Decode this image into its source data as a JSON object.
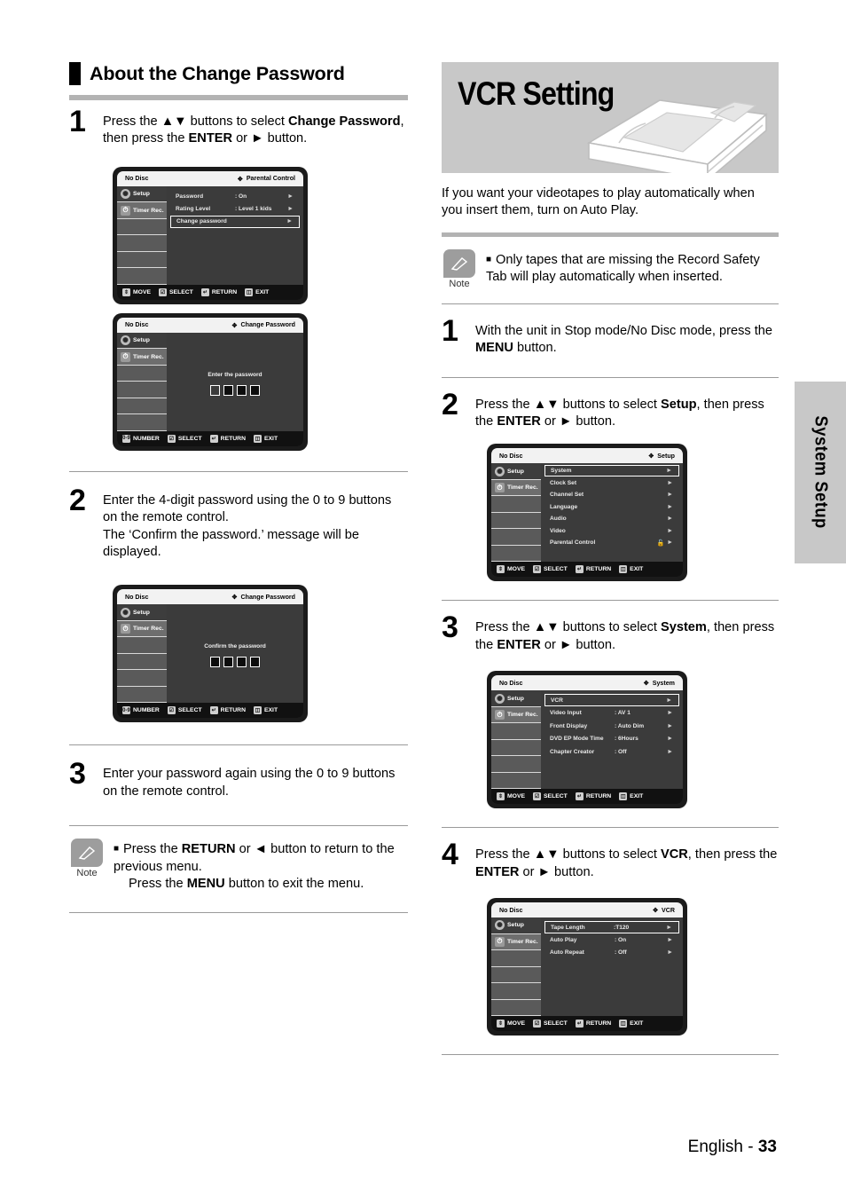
{
  "left": {
    "heading": "About the Change Password",
    "steps": [
      {
        "num": "1",
        "lines": [
          "Press the ▲▼ buttons to select ",
          "Change Password",
          ", then press the ",
          "ENTER",
          " or ► button."
        ]
      },
      {
        "num": "2",
        "line1": "Enter the 4-digit password using the 0 to 9 buttons on the remote control.",
        "line2": "The ‘Confirm the password.’ message will be displayed."
      },
      {
        "num": "3",
        "line1": "Enter your password again using the 0 to 9 buttons on the remote control."
      }
    ],
    "step1": {
      "pre": "Press the ▲▼ buttons to select ",
      "bold1": "Change Password",
      "mid": ", then press the ",
      "bold2": "ENTER",
      "post": " or ► button."
    },
    "note": {
      "label": "Note",
      "line1_pre": "Press the ",
      "line1_b": "RETURN",
      "line1_mid": " or ◄ button to return to the previous menu.",
      "line2_pre": "Press the ",
      "line2_b": "MENU",
      "line2_post": " button to exit the menu."
    }
  },
  "right": {
    "banner_title": "VCR Setting",
    "intro": "If you want your videotapes to play automatically when you insert them, turn on Auto Play.",
    "note": {
      "label": "Note",
      "text": "Only tapes that are missing the Record Safety Tab will play automatically when inserted."
    },
    "steps": {
      "s1": {
        "num": "1",
        "pre": "With the unit in Stop mode/No Disc mode, press the ",
        "b": "MENU",
        "post": " button."
      },
      "s2": {
        "num": "2",
        "pre": "Press the ▲▼ buttons to select ",
        "b1": "Setup",
        "mid": ", then press the ",
        "b2": "ENTER",
        "post": " or ► button."
      },
      "s3": {
        "num": "3",
        "pre": "Press the ▲▼ buttons to select ",
        "b1": "System",
        "mid": ", then press the ",
        "b2": "ENTER",
        "post": " or ► button."
      },
      "s4": {
        "num": "4",
        "pre": "Press the ▲▼ buttons to select ",
        "b1": "VCR",
        "mid": ", then press the ",
        "b2": "ENTER",
        "post": " or ► button."
      }
    }
  },
  "osd_common": {
    "disc_status": "No Disc",
    "side": {
      "setup": "Setup",
      "timer": "Timer Rec."
    },
    "foot_move": {
      "label": "MOVE",
      "icon": "updown-icon"
    },
    "foot_number": {
      "label": "NUMBER",
      "icon": "number-icon"
    },
    "foot_select": {
      "label": "SELECT",
      "icon": "enter-icon"
    },
    "foot_return": {
      "label": "RETURN",
      "icon": "return-icon"
    },
    "foot_exit": {
      "label": "EXIT",
      "icon": "exit-icon"
    }
  },
  "osd1": {
    "title": "Parental Control",
    "rows": [
      {
        "label": "Password",
        "value": ": On"
      },
      {
        "label": "Rating Level",
        "value": ": Level 1 kids"
      },
      {
        "label": "Change password",
        "value": "",
        "selected": true
      }
    ]
  },
  "osd2": {
    "title": "Change Password",
    "message": "Enter the password",
    "boxes": [
      "empty",
      "filled",
      "filled",
      "filled"
    ]
  },
  "osd3": {
    "title": "Change Password",
    "message": "Confirm the password",
    "boxes": [
      "filled",
      "filled",
      "filled",
      "filled"
    ]
  },
  "osd4": {
    "title": "Setup",
    "rows": [
      {
        "label": "System",
        "value": "",
        "selected": true
      },
      {
        "label": "Clock Set",
        "value": ""
      },
      {
        "label": "Channel Set",
        "value": ""
      },
      {
        "label": "Language",
        "value": ""
      },
      {
        "label": "Audio",
        "value": ""
      },
      {
        "label": "Video",
        "value": ""
      },
      {
        "label": "Parental Control",
        "value": "",
        "lock": "🔓"
      }
    ]
  },
  "osd5": {
    "title": "System",
    "rows": [
      {
        "label": "VCR",
        "value": "",
        "selected": true
      },
      {
        "label": "Video Input",
        "value": ": AV 1"
      },
      {
        "label": "Front Display",
        "value": ": Auto Dim"
      },
      {
        "label": "DVD EP Mode Time",
        "value": ": 6Hours"
      },
      {
        "label": "Chapter Creator",
        "value": ": Off"
      }
    ]
  },
  "osd6": {
    "title": "VCR",
    "rows": [
      {
        "label": "Tape Length",
        "value": ":T120",
        "selected": true
      },
      {
        "label": "Auto Play",
        "value": ": On"
      },
      {
        "label": "Auto Repeat",
        "value": ": Off"
      }
    ]
  },
  "side_tab": {
    "label": "System Setup"
  },
  "footer": {
    "language": "English - ",
    "page": "33"
  },
  "colors": {
    "accent_gray": "#c8c8c8",
    "rule": "#9a9a9a",
    "osd_bg": "#3b3b3b"
  }
}
